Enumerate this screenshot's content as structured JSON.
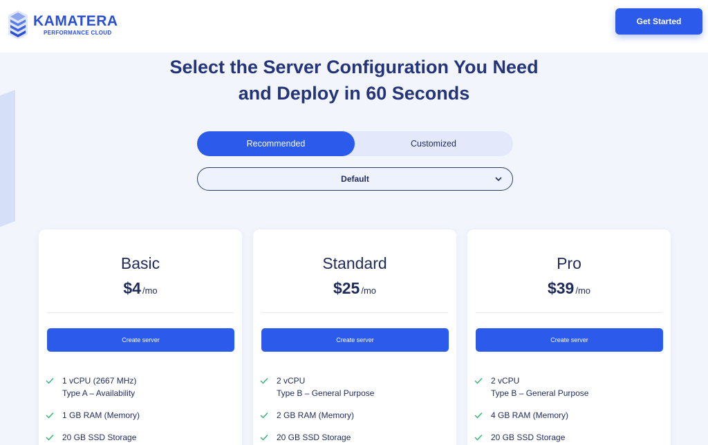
{
  "header": {
    "brand_name": "KAMATERA",
    "brand_sub": "PERFORMANCE CLOUD",
    "cta_label": "Get Started"
  },
  "hero": {
    "title_line1": "Select the Server Configuration You Need",
    "title_line2": "and Deploy in 60 Seconds"
  },
  "toggle": {
    "recommended_label": "Recommended",
    "customized_label": "Customized"
  },
  "select": {
    "value": "Default"
  },
  "plans": [
    {
      "name": "Basic",
      "price": "$4",
      "unit": "/mo",
      "button": "Create server",
      "features": [
        {
          "main": "1 vCPU (2667 MHz)",
          "sub": "Type A – Availability"
        },
        {
          "main": "1 GB RAM (Memory)",
          "sub": ""
        },
        {
          "main": "20 GB SSD Storage",
          "sub": ""
        }
      ]
    },
    {
      "name": "Standard",
      "price": "$25",
      "unit": "/mo",
      "button": "Create server",
      "features": [
        {
          "main": "2 vCPU",
          "sub": "Type B – General Purpose"
        },
        {
          "main": "2 GB RAM (Memory)",
          "sub": ""
        },
        {
          "main": "20 GB SSD Storage",
          "sub": ""
        }
      ]
    },
    {
      "name": "Pro",
      "price": "$39",
      "unit": "/mo",
      "button": "Create server",
      "features": [
        {
          "main": "2 vCPU",
          "sub": "Type B – General Purpose"
        },
        {
          "main": "4 GB RAM (Memory)",
          "sub": ""
        },
        {
          "main": "20 GB SSD Storage",
          "sub": ""
        }
      ]
    }
  ],
  "colors": {
    "accent": "#2c5aea",
    "brand": "#2a4fd6",
    "heading": "#23347a",
    "check": "#2bb673"
  }
}
